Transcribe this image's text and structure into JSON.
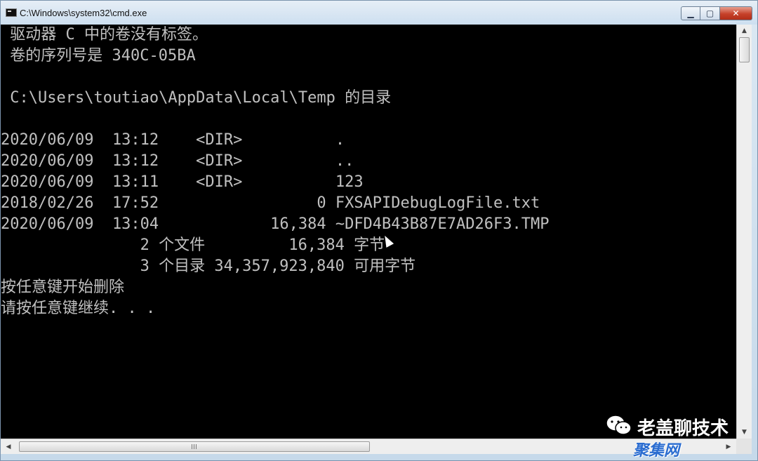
{
  "window": {
    "title": "C:\\Windows\\system32\\cmd.exe",
    "icon": "console-icon",
    "buttons": {
      "minimize": "▁",
      "maximize": "▢",
      "close": "✕"
    }
  },
  "console": {
    "lines": [
      " 驱动器 C 中的卷没有标签。",
      " 卷的序列号是 340C-05BA",
      "",
      " C:\\Users\\toutiao\\AppData\\Local\\Temp 的目录",
      "",
      "2020/06/09  13:12    <DIR>          .",
      "2020/06/09  13:12    <DIR>          ..",
      "2020/06/09  13:11    <DIR>          123",
      "2018/02/26  17:52                 0 FXSAPIDebugLogFile.txt",
      "2020/06/09  13:04            16,384 ~DFD4B43B87E7AD26F3.TMP",
      "               2 个文件         16,384 字节",
      "               3 个目录 34,357,923,840 可用字节",
      "按任意键开始删除",
      "请按任意键继续. . ."
    ]
  },
  "scrollbars": {
    "vertical": {
      "up": "▲",
      "down": "▼"
    },
    "horizontal": {
      "left": "◀",
      "right": "▶"
    }
  },
  "watermark": {
    "name": "老盖聊技术",
    "site": "聚集网",
    "icon": "wechat-icon"
  }
}
